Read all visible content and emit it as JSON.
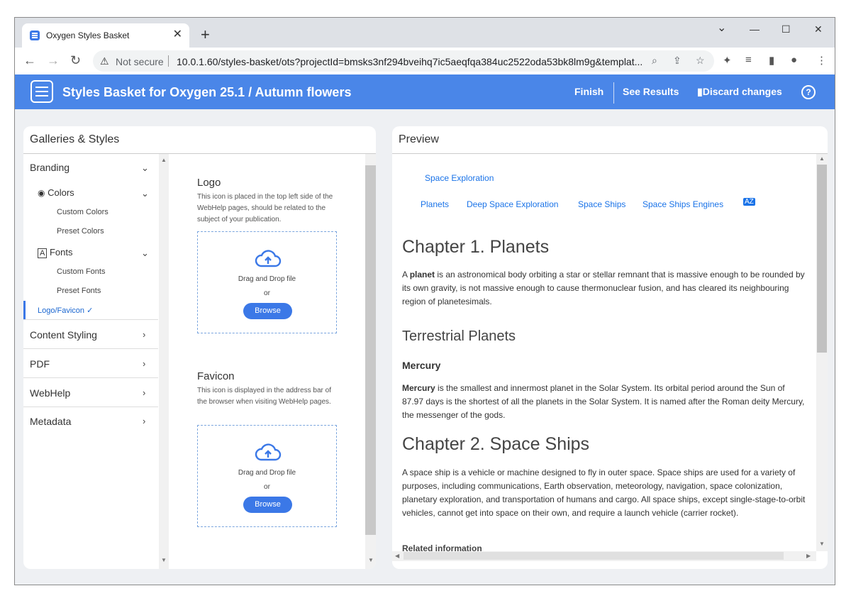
{
  "browser": {
    "tab_title": "Oxygen Styles Basket",
    "tab_close": "✕",
    "new_tab": "+",
    "window_controls": {
      "minimize": "—",
      "maximize": "☐",
      "close": "✕",
      "tab_search": "⌄"
    },
    "not_secure": "Not secure",
    "url": "10.0.1.60/styles-basket/ots?projectId=bmsks3nf294bveihq7ic5aeqfqa384uc2522oda53bk8lm9g&templat..."
  },
  "app": {
    "title": "Styles Basket for Oxygen 25.1 / Autumn flowers",
    "actions": {
      "finish": "Finish",
      "see_results": "See Results",
      "discard": "Discard changes",
      "help": "?"
    },
    "accent_color": "#4a86e8"
  },
  "left_panel": {
    "title": "Galleries & Styles",
    "nav": {
      "branding": "Branding",
      "colors": "Colors",
      "custom_colors": "Custom Colors",
      "preset_colors": "Preset Colors",
      "fonts": "Fonts",
      "custom_fonts": "Custom Fonts",
      "preset_fonts": "Preset Fonts",
      "logo_favicon": "Logo/Favicon",
      "content_styling": "Content Styling",
      "pdf": "PDF",
      "webhelp": "WebHelp",
      "metadata": "Metadata"
    },
    "logo": {
      "title": "Logo",
      "description": "This icon is placed in the top left side of the WebHelp pages, should be related to the subject of your publication.",
      "drop_text": "Drag and Drop file",
      "or": "or",
      "browse": "Browse"
    },
    "favicon": {
      "title": "Favicon",
      "description": "This icon is displayed in the address bar of the browser when visiting WebHelp pages.",
      "drop_text": "Drag and Drop file",
      "or": "or",
      "browse": "Browse"
    }
  },
  "preview": {
    "title": "Preview",
    "top_link": "Space Exploration",
    "links": [
      "Planets",
      "Deep Space Exploration",
      "Space Ships",
      "Space Ships Engines"
    ],
    "ch1_title": "Chapter 1. Planets",
    "ch1_p_lead": "A ",
    "ch1_p_bold": "planet",
    "ch1_p_rest": " is an astronomical body orbiting a star or stellar remnant that is massive enough to be rounded by its own gravity, is not massive enough to cause thermonuclear fusion, and has cleared its neighbouring region of planetesimals.",
    "terrestrial": "Terrestrial Planets",
    "mercury": "Mercury",
    "mercury_bold": "Mercury",
    "mercury_rest": " is the smallest and innermost planet in the Solar System. Its orbital period around the Sun of 87.97 days is the shortest of all the planets in the Solar System. It is named after the Roman deity Mercury, the messenger of the gods.",
    "ch2_title": "Chapter 2. Space Ships",
    "ch2_p": "A space ship is a vehicle or machine designed to fly in outer space. Space ships are used for a variety of purposes, including communications, Earth observation, meteorology, navigation, space colonization, planetary exploration, and transportation of humans and cargo. All space ships, except single-stage-to-orbit vehicles, cannot get into space on their own, and require a launch vehicle (carrier rocket).",
    "related": "Related information"
  }
}
